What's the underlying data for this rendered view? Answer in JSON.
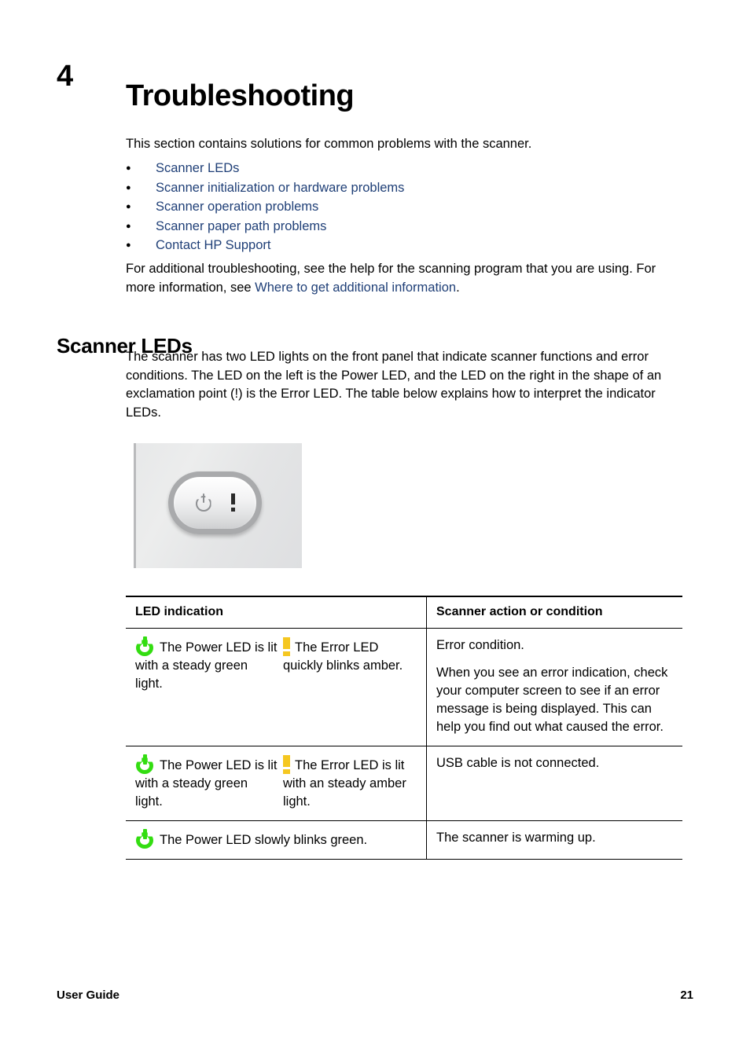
{
  "chapter": {
    "number": "4",
    "title": "Troubleshooting"
  },
  "intro": {
    "text": "This section contains solutions for common problems with the scanner."
  },
  "toc_links": [
    {
      "label": "Scanner LEDs"
    },
    {
      "label": "Scanner initialization or hardware problems"
    },
    {
      "label": "Scanner operation problems"
    },
    {
      "label": "Scanner paper path problems"
    },
    {
      "label": "Contact HP Support"
    }
  ],
  "additional": {
    "line1": "For additional troubleshooting, see the help for the scanning program that you are using.",
    "line2_before": "For more information, see ",
    "link": "Where to get additional information",
    "line2_after": "."
  },
  "section": {
    "heading": "Scanner LEDs",
    "description": "The scanner has two LED lights on the front panel that indicate scanner functions and error conditions. The LED on the left is the Power LED, and the LED on the right in the shape of an exclamation point (!) is the Error LED. The table below explains how to interpret the indicator LEDs."
  },
  "figure": {
    "name": "scanner-front-panel-button",
    "power_icon": "power-symbol-icon",
    "error_icon": "exclamation-mark-icon"
  },
  "table": {
    "headers": {
      "left": "LED indication",
      "right": "Scanner action or condition"
    },
    "rows": [
      {
        "power_icon": "power-led-green-icon",
        "power_text": "The Power LED is lit with a steady green light.",
        "error_icon": "error-led-amber-icon",
        "error_text": "The Error LED quickly blinks amber.",
        "condition_p1": "Error condition.",
        "condition_p2": "When you see an error indication, check your computer screen to see if an error message is being displayed. This can help you find out what caused the error."
      },
      {
        "power_icon": "power-led-green-icon",
        "power_text": "The Power LED is lit with a steady green light.",
        "error_icon": "error-led-amber-icon",
        "error_text": "The Error LED is lit with an steady amber light.",
        "condition_p1": "USB cable is not connected.",
        "condition_p2": ""
      },
      {
        "power_icon": "power-led-green-icon",
        "power_text": "The Power LED slowly blinks green.",
        "error_icon": "",
        "error_text": "",
        "condition_p1": "The scanner is warming up.",
        "condition_p2": ""
      }
    ]
  },
  "footer": {
    "left": "User Guide",
    "page": "21"
  },
  "colors": {
    "link": "#1F3F77",
    "led_green": "#33DD11",
    "led_amber": "#F5C720",
    "text": "#000000"
  }
}
